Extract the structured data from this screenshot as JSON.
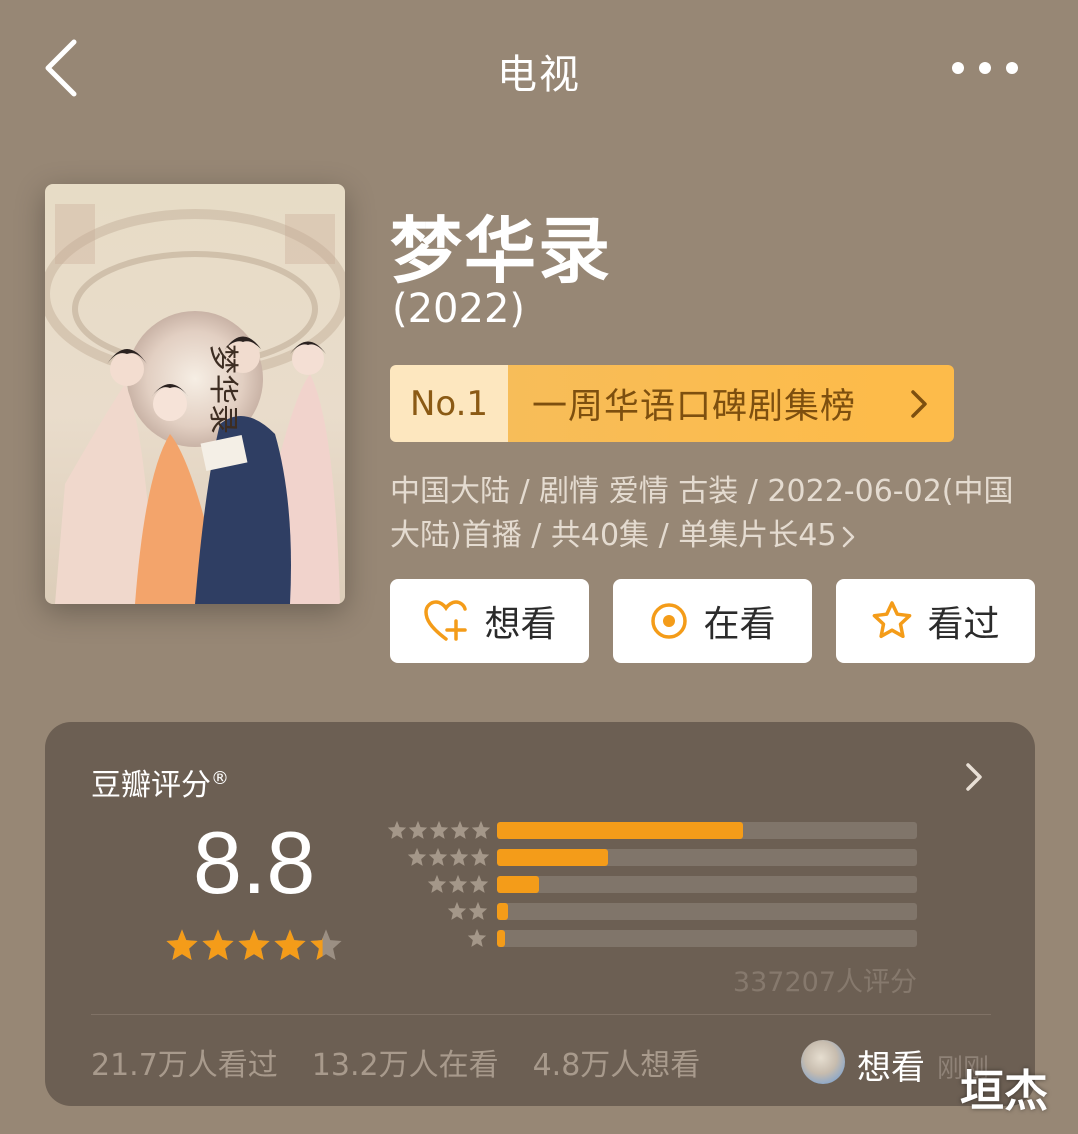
{
  "nav": {
    "title": "电视",
    "back_icon": "chevron-left-icon",
    "more_icon": "more-dots-icon"
  },
  "show": {
    "title": "梦华录",
    "year": "(2022)",
    "poster_title": "梦华录",
    "rank": {
      "no": "No.1",
      "label": "一周华语口碑剧集榜"
    },
    "meta": "中国大陆 / 剧情 爱情 古装 / 2022-06-02(中国大陆)首播 / 共40集 / 单集片长45"
  },
  "actions": [
    {
      "label": "想看",
      "icon": "heart-plus-icon"
    },
    {
      "label": "在看",
      "icon": "target-circle-icon"
    },
    {
      "label": "看过",
      "icon": "star-outline-icon"
    }
  ],
  "rating": {
    "header": "豆瓣评分",
    "reg": "®",
    "score": "8.8",
    "stars_value": 4.4,
    "distribution": [
      {
        "stars": 5,
        "fraction": 0.585
      },
      {
        "stars": 4,
        "fraction": 0.265
      },
      {
        "stars": 3,
        "fraction": 0.1
      },
      {
        "stars": 2,
        "fraction": 0.025
      },
      {
        "stars": 1,
        "fraction": 0.018
      }
    ],
    "raters": "337207人评分",
    "watched": "21.7万人看过",
    "watching": "13.2万人在看",
    "want": "4.8万人想看",
    "friend_action": "想看",
    "friend_time": "刚刚"
  },
  "colors": {
    "background": "#978775",
    "card": "#6c5f53",
    "accent": "#f49c19",
    "rank_bg": "#fdbb4a"
  },
  "watermark": "垣杰"
}
